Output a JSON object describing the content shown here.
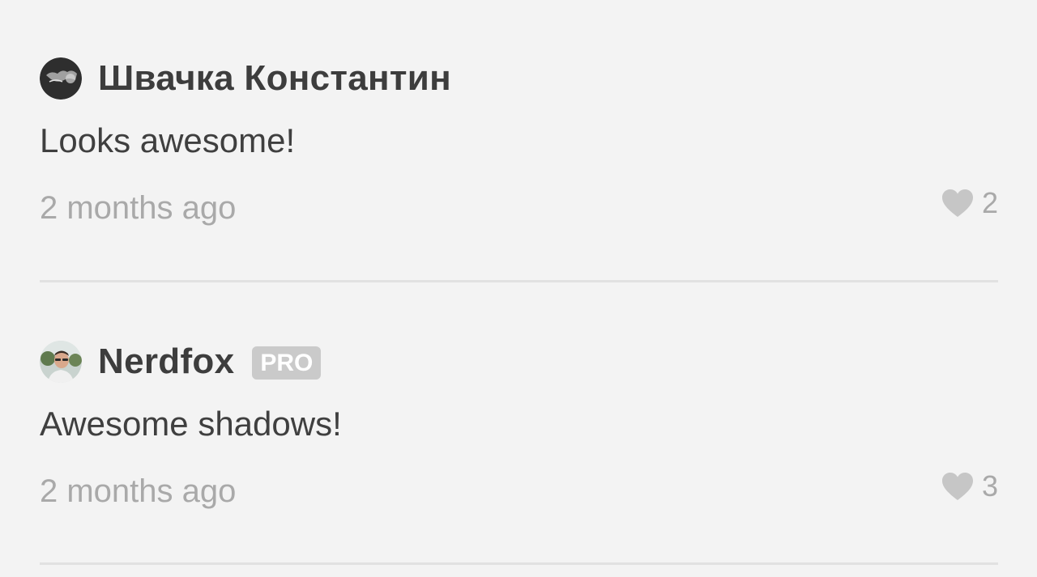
{
  "comments": [
    {
      "author": "Швачка Константин",
      "avatar_icon": "user-avatar-dark",
      "pro_badge": "",
      "text": "Looks awesome!",
      "time": "2 months ago",
      "likes": "2",
      "like_icon": "heart-icon"
    },
    {
      "author": "Nerdfox",
      "avatar_icon": "user-avatar-photo",
      "pro_badge": "PRO",
      "text": "Awesome shadows!",
      "time": "2 months ago",
      "likes": "3",
      "like_icon": "heart-icon"
    }
  ],
  "colors": {
    "background": "#f3f3f3",
    "author_text": "#3d3d3d",
    "muted_text": "#a9a9a9",
    "heart": "#c6c6c6",
    "badge_bg": "#cacaca",
    "divider": "#e1e1e1"
  }
}
